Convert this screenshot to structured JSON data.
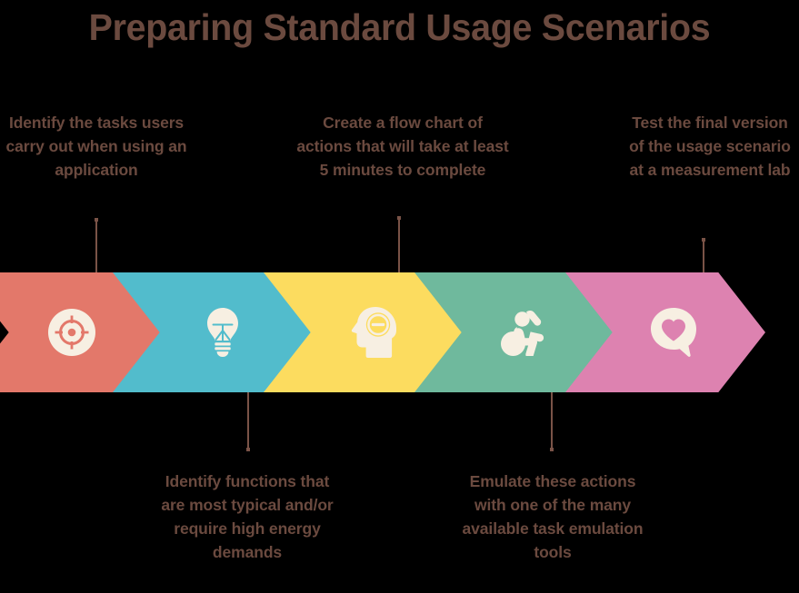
{
  "page": {
    "title": "Preparing Standard Usage Scenarios",
    "background_color": "#000000",
    "text_color": "#6B4A3F",
    "icon_color": "#F7EFE2",
    "connector_color": "#7A5347"
  },
  "steps": [
    {
      "index": 1,
      "icon": "target-crosshair-icon",
      "color": "#E3786A",
      "caption": "Identify the tasks users carry out when using an application",
      "caption_position": "above"
    },
    {
      "index": 2,
      "icon": "lightbulb-icon",
      "color": "#52BCCC",
      "caption": "Identify functions that are most typical and/or require high energy demands",
      "caption_position": "below"
    },
    {
      "index": 3,
      "icon": "head-profile-minus-icon",
      "color": "#FCDC5F",
      "caption": "Create a flow chart of actions that will take at least 5 minutes to complete",
      "caption_position": "above"
    },
    {
      "index": 4,
      "icon": "person-exercise-icon",
      "color": "#6FB99D",
      "caption": "Emulate these actions with one of the many available task emulation tools",
      "caption_position": "below"
    },
    {
      "index": 5,
      "icon": "speech-bubble-heart-icon",
      "color": "#DD82B0",
      "caption": "Test the final version of the usage scenario at a measurement lab",
      "caption_position": "above"
    }
  ]
}
